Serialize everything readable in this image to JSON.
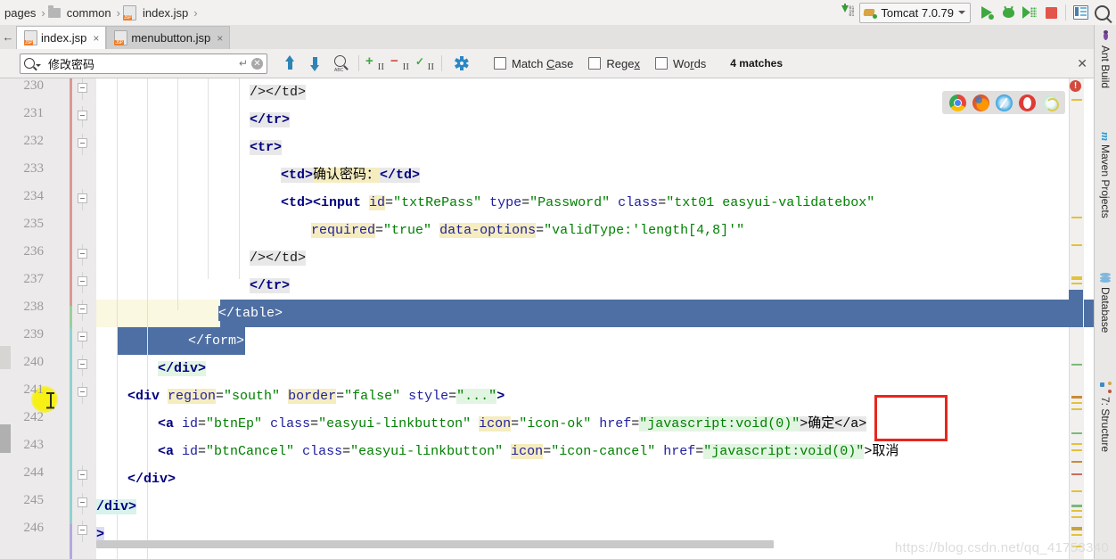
{
  "breadcrumb": {
    "items": [
      {
        "label": "pages",
        "icon": ""
      },
      {
        "label": "common",
        "icon": "folder-icon"
      },
      {
        "label": "index.jsp",
        "icon": "jsp-file-icon"
      }
    ],
    "separator": "›"
  },
  "toolbar": {
    "download_icon": "update-project-icon",
    "run_config": {
      "label": "Tomcat 7.0.79",
      "icon": "tomcat-icon",
      "chevron": "▾"
    },
    "run_label": "run-icon",
    "debug_label": "debug-icon",
    "coverage_label": "run-with-coverage-icon",
    "stop_label": "stop-icon",
    "layout_label": "layout-icon",
    "search_label": "search-everywhere-icon"
  },
  "tabs": {
    "back_arrow": "←",
    "items": [
      {
        "label": "index.jsp",
        "icon": "jsp-file-icon",
        "close": "×",
        "active": true
      },
      {
        "label": "menubutton.jsp",
        "icon": "jsp-file-icon",
        "close": "×",
        "active": false
      }
    ]
  },
  "find": {
    "query": "修改密码",
    "enter_hint": "↵",
    "clear": "✕",
    "prev_icon": "find-previous-icon",
    "next_icon": "find-next-icon",
    "find_all_icon": "find-all-icon",
    "add_occurrence_icon": "add-occurrence-icon",
    "remove_occurrence_icon": "remove-occurrence-icon",
    "select_all_occurrences_icon": "select-all-occurrences-icon",
    "settings_icon": "find-settings-icon",
    "options": [
      {
        "label_pre": "Match ",
        "label_key": "C",
        "label_post": "ase"
      },
      {
        "label_pre": "Rege",
        "label_key": "x",
        "label_post": ""
      },
      {
        "label_pre": "Wo",
        "label_key": "r",
        "label_post": "ds"
      }
    ],
    "match_count": "4 matches",
    "close": "✕"
  },
  "browsers": [
    "chrome-icon",
    "firefox-icon",
    "safari-icon",
    "opera-icon",
    "edge-icon"
  ],
  "editor": {
    "first_line": 230,
    "lines": [
      {
        "n": 230,
        "indent": 0
      },
      {
        "n": 231,
        "indent": 0
      },
      {
        "n": 232,
        "indent": 0
      },
      {
        "n": 233,
        "indent": 0
      },
      {
        "n": 234,
        "indent": 0
      },
      {
        "n": 235,
        "indent": 0
      },
      {
        "n": 236,
        "indent": 0
      },
      {
        "n": 237,
        "indent": 0
      },
      {
        "n": 238,
        "indent": 0
      },
      {
        "n": 239,
        "indent": 0
      },
      {
        "n": 240,
        "indent": 0
      },
      {
        "n": 241,
        "indent": 0
      },
      {
        "n": 242,
        "indent": 0
      },
      {
        "n": 243,
        "indent": 0
      },
      {
        "n": 244,
        "indent": 0
      },
      {
        "n": 245,
        "indent": 0
      },
      {
        "n": 246,
        "indent": 0
      }
    ],
    "code": {
      "l230": "/></td>",
      "l231": "</tr>",
      "l232": "<tr>",
      "l233_a": "<td>",
      "l233_b": "确认密码：",
      "l233_c": "</td>",
      "l234_a": "<td><input ",
      "l234_id": "id",
      "l234_idv": "\"txtRePass\"",
      "l234_type": "type",
      "l234_typev": "\"Password\"",
      "l234_class": "class",
      "l234_classv": "\"txt01 easyui-validatebox\"",
      "l235_req": "required",
      "l235_reqv": "\"true\"",
      "l235_do": "data-options",
      "l235_dov": "\"validType:'length[4,8]'\"",
      "l236": "/></td>",
      "l237": "</tr>",
      "l238": "</table>",
      "l239": "</form>",
      "l240": "</div>",
      "l241_a": "<div ",
      "l241_region": "region",
      "l241_regionv": "\"south\"",
      "l241_border": "border",
      "l241_borderv": "\"false\"",
      "l241_style": "style",
      "l241_stylev": "\"...\"",
      "l241_end": ">",
      "l242_a": "<a ",
      "l242_id": "id",
      "l242_idv": "\"btnEp\"",
      "l242_class": "class",
      "l242_classv": "\"easyui-linkbutton\"",
      "l242_icon": "icon",
      "l242_iconv": "\"icon-ok\"",
      "l242_href": "href",
      "l242_hrefv": "\"javascript:void(0)\"",
      "l242_text": ">确定</a>",
      "l243_a": "<a ",
      "l243_id": "id",
      "l243_idv": "\"btnCancel\"",
      "l243_class": "class",
      "l243_classv": "\"easyui-linkbutton\"",
      "l243_icon": "icon",
      "l243_iconv": "\"icon-cancel\"",
      "l243_href": "href",
      "l243_hrefv": "\"javascript:void(0)\"",
      "l243_text": ">取消",
      "l244": "</div>",
      "l245": "/div>",
      "l246": ">"
    }
  },
  "right_tool_tabs": [
    {
      "label": "Ant Build",
      "icon": "ant-icon"
    },
    {
      "label": "Maven Projects",
      "icon": "maven-icon"
    },
    {
      "label": "Database",
      "icon": "database-icon"
    },
    {
      "label": "7: Structure",
      "icon": "structure-icon"
    }
  ],
  "status": {
    "error_badge": "!"
  },
  "watermark": "https://blog.csdn.net/qq_41753340",
  "colors": {
    "selection_blue": "#4e6fa3",
    "occurrence_yellow": "#f5edc0",
    "annotation_red": "#e8261c",
    "caret_line": "#faf8e0",
    "tag": "#000080",
    "attr": "#2020a0",
    "value": "#008000"
  }
}
